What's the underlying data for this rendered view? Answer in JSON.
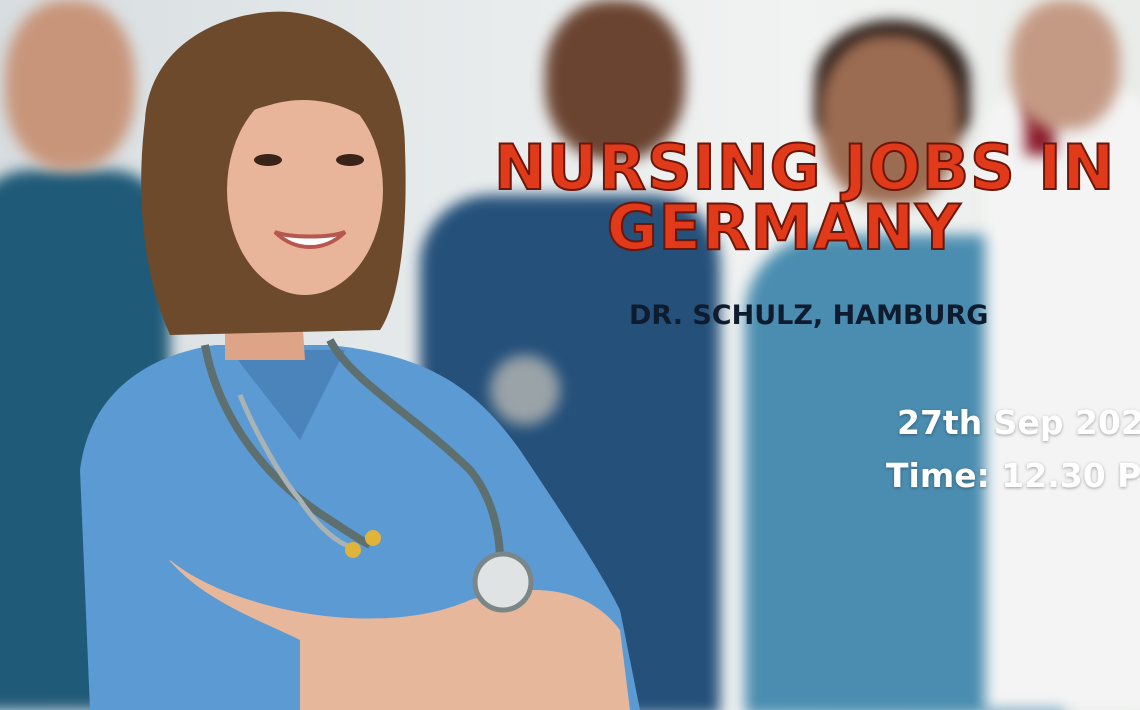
{
  "banner": {
    "title_line1": "NURSING JOBS IN",
    "title_line2": "GERMANY",
    "subtitle": "DR. SCHULZ, HAMBURG",
    "date": "27th Sep 202",
    "time": "Time: 12.30 P"
  },
  "colors": {
    "title": "#e03a1a",
    "subtitle": "#0f1b2e",
    "date_time": "#ffffff",
    "scrubs": "#5b9ad3"
  },
  "image": {
    "icon": "nurse-with-stethoscope-photo"
  }
}
